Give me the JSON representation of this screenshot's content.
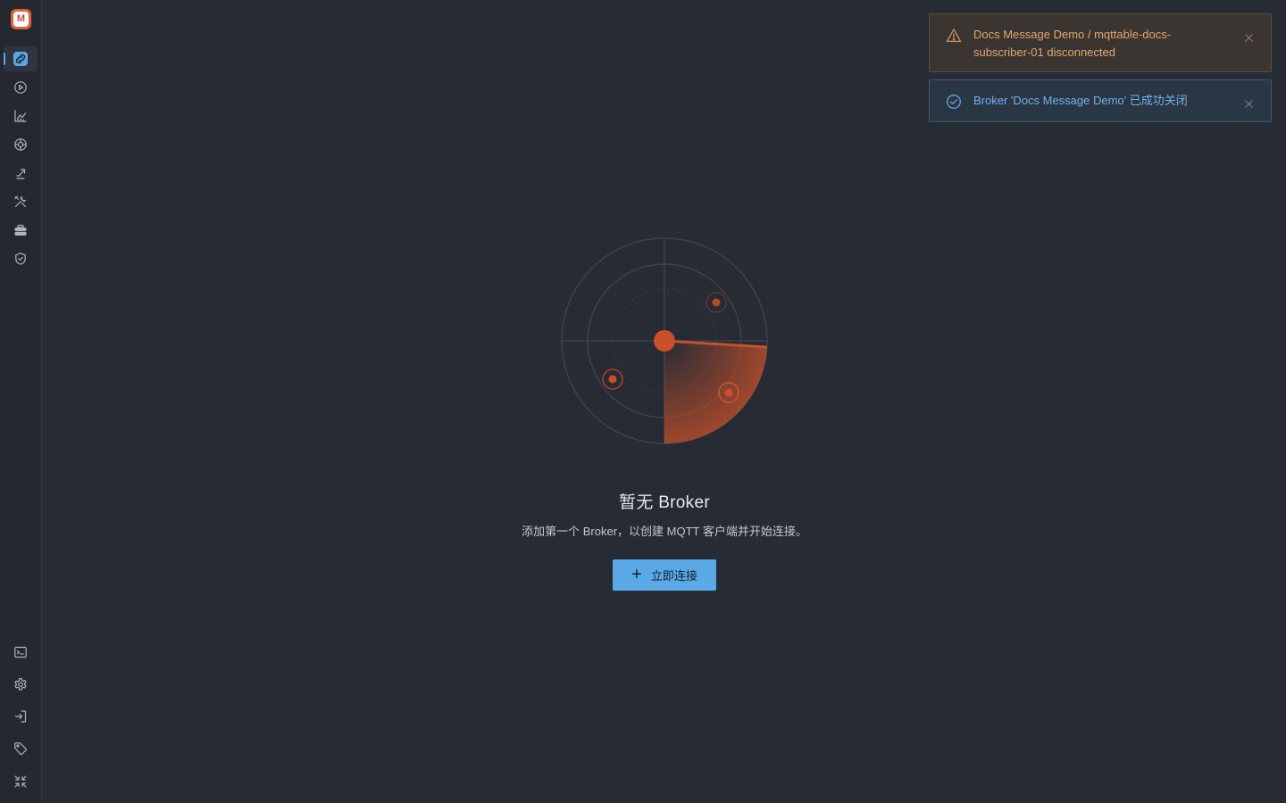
{
  "app": {
    "logo_letter": "M"
  },
  "sidebar": {
    "top_items": [
      {
        "name": "brokers",
        "icon": "link-icon",
        "active": true
      },
      {
        "name": "run",
        "icon": "play-circle-icon"
      },
      {
        "name": "analytics",
        "icon": "chart-icon"
      },
      {
        "name": "explore",
        "icon": "aperture-icon"
      },
      {
        "name": "publish",
        "icon": "send-icon"
      },
      {
        "name": "tools",
        "icon": "tools-icon"
      },
      {
        "name": "toolbox",
        "icon": "briefcase-icon"
      },
      {
        "name": "security",
        "icon": "shield-icon"
      }
    ],
    "bottom_items": [
      {
        "name": "terminal",
        "icon": "terminal-icon"
      },
      {
        "name": "settings",
        "icon": "gear-icon"
      },
      {
        "name": "login",
        "icon": "login-icon"
      },
      {
        "name": "tags",
        "icon": "tag-icon"
      },
      {
        "name": "collapse",
        "icon": "collapse-icon"
      }
    ]
  },
  "empty_state": {
    "title": "暂无 Broker",
    "subtitle": "添加第一个 Broker，以创建 MQTT 客户端并开始连接。",
    "button_label": "立即连接"
  },
  "notifications": [
    {
      "type": "warning",
      "message": "Docs Message Demo / mqttable-docs-subscriber-01 disconnected"
    },
    {
      "type": "success",
      "message": "Broker 'Docs Message Demo' 已成功关闭"
    }
  ],
  "colors": {
    "accent": "#5aa9e6",
    "brand": "#e0603a",
    "radar_accent": "#c8502a",
    "warning_text": "#e2a670",
    "success_text": "#6db3ec",
    "background": "#272b34"
  }
}
